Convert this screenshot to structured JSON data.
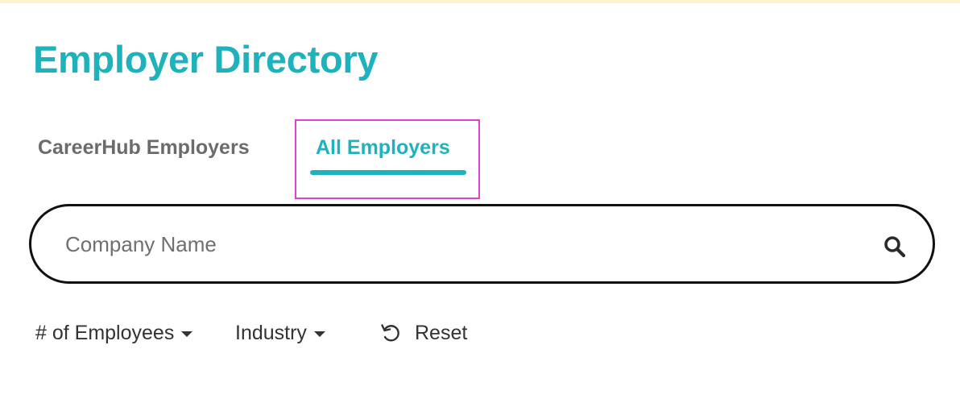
{
  "page": {
    "title": "Employer Directory"
  },
  "tabs": [
    {
      "label": "CareerHub Employers",
      "active": false
    },
    {
      "label": "All Employers",
      "active": true
    }
  ],
  "search": {
    "placeholder": "Company Name",
    "value": "",
    "icon": "search-icon"
  },
  "filters": {
    "employees_label": "# of Employees",
    "industry_label": "Industry",
    "reset_label": "Reset",
    "reset_icon": "reset-icon",
    "caret_icon": "caret-down-icon"
  },
  "colors": {
    "accent": "#1eb2bd",
    "tab_inactive": "#6b6b6b",
    "highlight": "#e041c8",
    "banner": "#fdf3d2",
    "text": "#333333"
  }
}
